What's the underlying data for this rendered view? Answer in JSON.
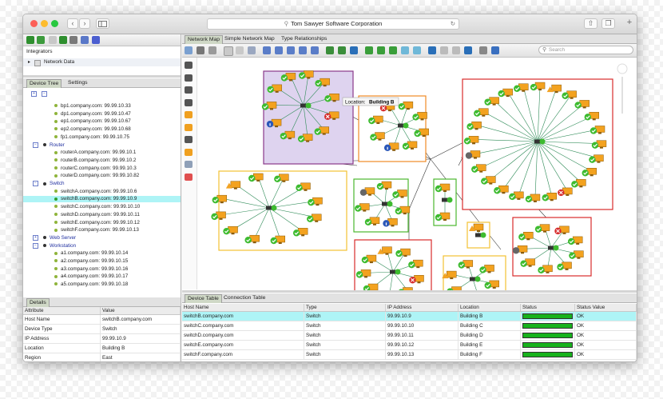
{
  "browser": {
    "address": "Tom Sawyer Software Corporation",
    "back": "‹",
    "forward": "›",
    "new_tab": "+"
  },
  "integrators": {
    "title": "Integrators",
    "item": "Network Data"
  },
  "left_tabs": [
    "Device Tree",
    "Settings"
  ],
  "tree": [
    {
      "kind": "leaf",
      "text": "bp1.company.com: 99.99.10.33"
    },
    {
      "kind": "leaf",
      "text": "dp1.company.com: 99.99.10.47"
    },
    {
      "kind": "leaf",
      "text": "ep1.company.com: 99.99.10.67"
    },
    {
      "kind": "leaf",
      "text": "ep2.company.com: 99.99.10.68"
    },
    {
      "kind": "leaf",
      "text": "fp1.company.com: 99.99.10.75"
    },
    {
      "kind": "group",
      "sign": "−",
      "text": "Router"
    },
    {
      "kind": "leaf",
      "text": "routerA.company.com: 99.99.10.1"
    },
    {
      "kind": "leaf",
      "text": "routerB.company.com: 99.99.10.2"
    },
    {
      "kind": "leaf",
      "text": "routerC.company.com: 99.99.10.3"
    },
    {
      "kind": "leaf",
      "text": "routerD.company.com: 99.99.10.82"
    },
    {
      "kind": "group",
      "sign": "−",
      "text": "Switch"
    },
    {
      "kind": "leaf",
      "text": "switchA.company.com: 99.99.10.6"
    },
    {
      "kind": "leaf",
      "text": "switchB.company.com: 99.99.10.9",
      "selected": true
    },
    {
      "kind": "leaf",
      "text": "switchC.company.com: 99.99.10.10"
    },
    {
      "kind": "leaf",
      "text": "switchD.company.com: 99.99.10.11"
    },
    {
      "kind": "leaf",
      "text": "switchE.company.com: 99.99.10.12"
    },
    {
      "kind": "leaf",
      "text": "switchF.company.com: 99.99.10.13"
    },
    {
      "kind": "group",
      "sign": "+",
      "text": "Web Server"
    },
    {
      "kind": "group",
      "sign": "−",
      "text": "Workstation"
    },
    {
      "kind": "leaf",
      "text": "a1.company.com: 99.99.10.14"
    },
    {
      "kind": "leaf",
      "text": "a2.company.com: 99.99.10.15"
    },
    {
      "kind": "leaf",
      "text": "a3.company.com: 99.99.10.16"
    },
    {
      "kind": "leaf",
      "text": "a4.company.com: 99.99.10.17"
    },
    {
      "kind": "leaf",
      "text": "a5.company.com: 99.99.10.18"
    }
  ],
  "details": {
    "tab": "Details",
    "headers": [
      "Attribute",
      "Value"
    ],
    "rows": [
      [
        "Host Name",
        "switchB.company.com"
      ],
      [
        "Device Type",
        "Switch"
      ],
      [
        "IP Address",
        "99.99.10.9"
      ],
      [
        "Location",
        "Building B"
      ],
      [
        "Region",
        "East"
      ]
    ]
  },
  "map_tabs": [
    "Network Map",
    "Simple Network Map",
    "Type Relationships"
  ],
  "search": {
    "placeholder": "Search"
  },
  "tooltip": {
    "label": "Location:",
    "value": "Building B"
  },
  "device_tabs": [
    "Device Table",
    "Connection Table"
  ],
  "device_table": {
    "headers": [
      "Host Name",
      "Type",
      "IP Address",
      "Location",
      "Status",
      "Status Value"
    ],
    "rows": [
      {
        "host": "switchB.company.com",
        "type": "Switch",
        "ip": "99.99.10.9",
        "loc": "Building B",
        "status_value": "OK",
        "status_fill": 1.0,
        "selected": true
      },
      {
        "host": "switchC.company.com",
        "type": "Switch",
        "ip": "99.99.10.10",
        "loc": "Building C",
        "status_value": "OK",
        "status_fill": 1.0
      },
      {
        "host": "switchD.company.com",
        "type": "Switch",
        "ip": "99.99.10.11",
        "loc": "Building D",
        "status_value": "OK",
        "status_fill": 1.0
      },
      {
        "host": "switchE.company.com",
        "type": "Switch",
        "ip": "99.99.10.12",
        "loc": "Building E",
        "status_value": "OK",
        "status_fill": 1.0
      },
      {
        "host": "switchF.company.com",
        "type": "Switch",
        "ip": "99.99.10.13",
        "loc": "Building F",
        "status_value": "OK",
        "status_fill": 1.0
      }
    ]
  },
  "colors": {
    "accent_green": "#8fb43a",
    "status_ok": "#17b21c",
    "selected_row": "#aef4f6",
    "group_purple": "#8a3a8a",
    "group_orange": "#f08a24",
    "group_red": "#d92b2b",
    "group_yellow": "#f2c232",
    "group_green": "#4bb82e"
  }
}
